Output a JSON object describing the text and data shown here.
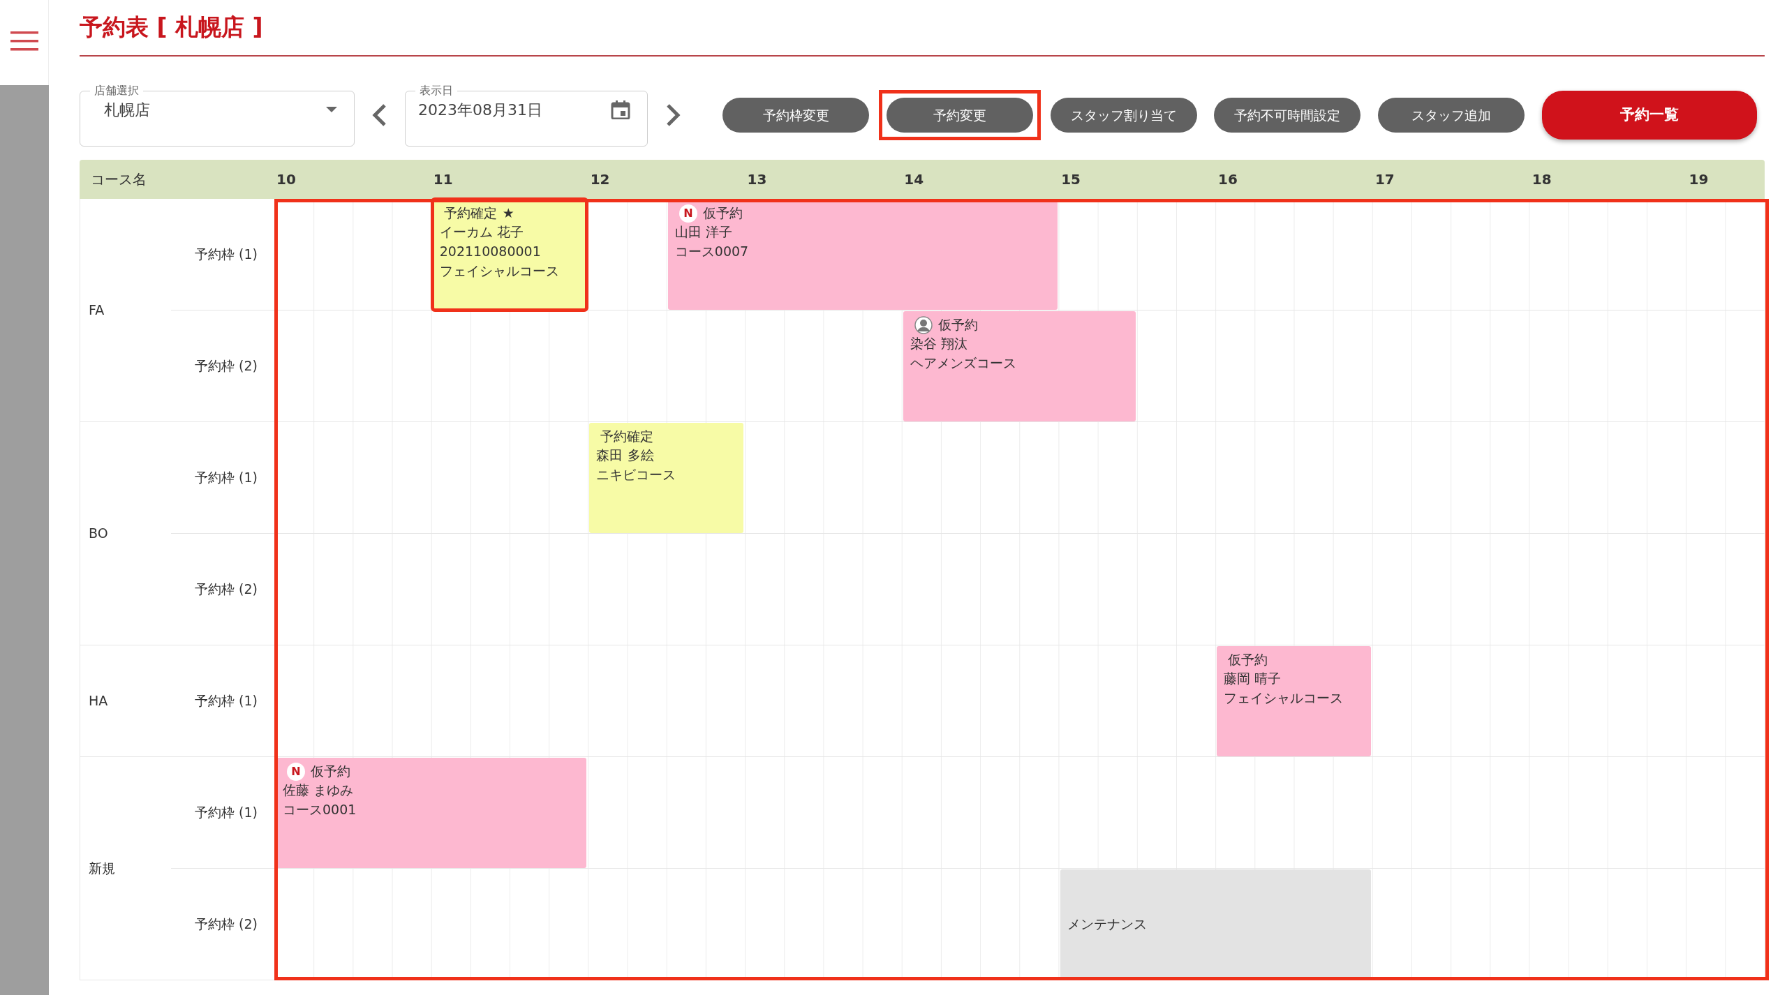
{
  "title": "予約表 [ 札幌店 ]",
  "store_select": {
    "label": "店舗選択",
    "value": "札幌店"
  },
  "date_field": {
    "label": "表示日",
    "value": "2023年08月31日"
  },
  "buttons": [
    {
      "label": "予約枠変更",
      "kind": "secondary",
      "highlighted": false
    },
    {
      "label": "予約変更",
      "kind": "secondary",
      "highlighted": true
    },
    {
      "label": "スタッフ割り当て",
      "kind": "secondary",
      "highlighted": false
    },
    {
      "label": "予約不可時間設定",
      "kind": "secondary",
      "highlighted": false
    },
    {
      "label": "スタッフ追加",
      "kind": "secondary",
      "highlighted": false
    },
    {
      "label": "予約一覧",
      "kind": "primary",
      "highlighted": false
    }
  ],
  "schedule": {
    "course_header": "コース名",
    "hours": [
      "10",
      "11",
      "12",
      "13",
      "14",
      "15",
      "16",
      "17",
      "18",
      "19"
    ],
    "highlighted": true,
    "groups": [
      {
        "name": "FA",
        "slots": [
          {
            "label": "予約枠 (1)",
            "events": [
              {
                "kind": "confirmed",
                "status": "予約確定",
                "star": "★",
                "marker": {
                  "kind": "none"
                },
                "lines": [
                  "イーカム 花子",
                  "202110080001",
                  "フェイシャルコース"
                ],
                "highlighted": true
              },
              {
                "kind": "tentative",
                "status": "仮予約",
                "marker": {
                  "kind": "letter",
                  "text": "N"
                },
                "lines": [
                  "山田 洋子",
                  "コース0007"
                ],
                "highlighted": false
              }
            ]
          },
          {
            "label": "予約枠 (2)",
            "events": [
              {
                "kind": "tentative",
                "status": "仮予約",
                "marker": {
                  "kind": "person"
                },
                "lines": [
                  "染谷 翔汰",
                  "ヘアメンズコース"
                ],
                "highlighted": false
              }
            ]
          }
        ]
      },
      {
        "name": "BO",
        "slots": [
          {
            "label": "予約枠 (1)",
            "events": [
              {
                "kind": "confirmed",
                "status": "予約確定",
                "marker": {
                  "kind": "none"
                },
                "lines": [
                  "森田 多絵",
                  "ニキビコース"
                ],
                "highlighted": false
              }
            ]
          },
          {
            "label": "予約枠 (2)"
          }
        ]
      },
      {
        "name": "HA",
        "slots": [
          {
            "label": "予約枠 (1)",
            "events": [
              {
                "kind": "tentative",
                "status": "仮予約",
                "marker": {
                  "kind": "none"
                },
                "lines": [
                  "藤岡 晴子",
                  "フェイシャルコース"
                ],
                "highlighted": false
              }
            ]
          }
        ]
      },
      {
        "name": "新規",
        "slots": [
          {
            "label": "予約枠 (1)",
            "events": [
              {
                "kind": "tentative",
                "status": "仮予約",
                "marker": {
                  "kind": "letter",
                  "text": "N"
                },
                "lines": [
                  "佐藤 まゆみ",
                  "コース0001"
                ],
                "highlighted": false
              }
            ]
          },
          {
            "label": "予約枠 (2)",
            "events": [
              {
                "kind": "maintenance",
                "marker": {
                  "kind": "none"
                },
                "lines": [
                  "メンテナンス"
                ],
                "highlighted": false
              }
            ]
          }
        ]
      }
    ]
  }
}
